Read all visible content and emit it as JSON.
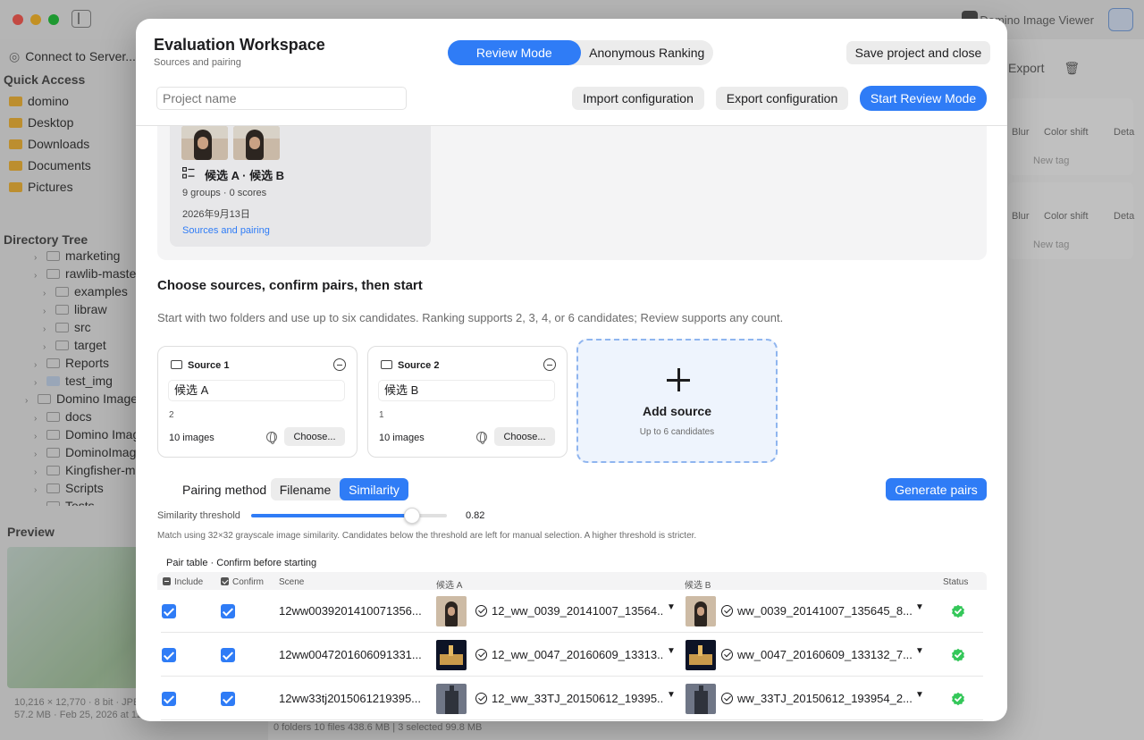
{
  "background": {
    "connect_label": "Connect to Server...",
    "quick_access_label": "Quick Access",
    "quick_access": [
      "domino",
      "Desktop",
      "Downloads",
      "Documents",
      "Pictures"
    ],
    "directory_tree_label": "Directory Tree",
    "tree": [
      {
        "label": "marketing",
        "indent": 1
      },
      {
        "label": "rawlib-master",
        "indent": 1
      },
      {
        "label": "examples",
        "indent": 2
      },
      {
        "label": "libraw",
        "indent": 2
      },
      {
        "label": "src",
        "indent": 2
      },
      {
        "label": "target",
        "indent": 2
      },
      {
        "label": "Reports",
        "indent": 1
      },
      {
        "label": "test_img",
        "indent": 1
      },
      {
        "label": "Domino Image",
        "indent": 0
      },
      {
        "label": "docs",
        "indent": 1
      },
      {
        "label": "Domino Image",
        "indent": 1
      },
      {
        "label": "DominoImage",
        "indent": 1
      },
      {
        "label": "Kingfisher-ma",
        "indent": 1
      },
      {
        "label": "Scripts",
        "indent": 1
      },
      {
        "label": "Tests",
        "indent": 1
      }
    ],
    "preview_label": "Preview",
    "preview_meta_1": "10,216 × 12,770 · 8 bit · JPE",
    "preview_meta_2": "57.2 MB · Feb 25, 2026 at 12",
    "app_title": "Domino Image Viewer",
    "export_label": "Export",
    "chips": [
      "Blur",
      "Color shift",
      "Deta"
    ],
    "new_tag_placeholder": "New tag",
    "status_bar": "0 folders   10 files   438.6 MB   |   3 selected   99.8 MB"
  },
  "modal": {
    "title": "Evaluation Workspace",
    "subtitle": "Sources and pairing",
    "modes": [
      {
        "label": "Review Mode",
        "active": true
      },
      {
        "label": "Anonymous Ranking",
        "active": false
      }
    ],
    "save_close_label": "Save project and close",
    "project_name_placeholder": "Project name",
    "import_label": "Import configuration",
    "export_label": "Export configuration",
    "start_label": "Start Review Mode",
    "recent": {
      "name": "候选 A · 候选 B",
      "groups_scores": "9 groups · 0 scores",
      "date": "2026年9月13日",
      "link": "Sources and pairing"
    },
    "section_title": "Choose sources, confirm pairs, then start",
    "section_desc": "Start with two folders and use up to six candidates. Ranking supports 2, 3, 4, or 6 candidates; Review supports any count.",
    "sources": [
      {
        "title": "Source 1",
        "name": "候选 A",
        "count": "2",
        "images": "10 images",
        "choose_label": "Choose..."
      },
      {
        "title": "Source 2",
        "name": "候选 B",
        "count": "1",
        "images": "10 images",
        "choose_label": "Choose..."
      }
    ],
    "add_source": {
      "label": "Add source",
      "sub": "Up to 6 candidates"
    },
    "pairing": {
      "label": "Pairing method",
      "options": [
        {
          "label": "Filename",
          "active": false
        },
        {
          "label": "Similarity",
          "active": true
        }
      ],
      "generate_label": "Generate pairs"
    },
    "threshold": {
      "label": "Similarity threshold",
      "value": 0.82,
      "value_text": "0.82",
      "note": "Match using 32×32 grayscale image similarity. Candidates below the threshold are left for manual selection. A higher threshold is stricter."
    },
    "pair_table": {
      "title": "Pair table · Confirm before starting",
      "headers": {
        "include": "Include",
        "confirm": "Confirm",
        "scene": "Scene",
        "cand_a": "候选 A",
        "cand_b": "候选 B",
        "status": "Status"
      },
      "rows": [
        {
          "scene": "12ww0039201410071356...",
          "a_file": "12_ww_0039_20141007_13564...",
          "b_file": "ww_0039_20141007_135645_8...",
          "thumb": "portrait",
          "include": true,
          "confirm": true,
          "status": "matched"
        },
        {
          "scene": "12ww0047201606091331...",
          "a_file": "12_ww_0047_20160609_13313...",
          "b_file": "ww_0047_20160609_133132_7...",
          "thumb": "night",
          "include": true,
          "confirm": true,
          "status": "matched"
        },
        {
          "scene": "12ww33tj2015061219395...",
          "a_file": "12_ww_33TJ_20150612_19395...",
          "b_file": "ww_33TJ_20150612_193954_2...",
          "thumb": "dusk",
          "include": true,
          "confirm": true,
          "status": "matched"
        }
      ]
    },
    "colors": {
      "accent": "#2f7cf6",
      "success": "#34c759"
    }
  }
}
